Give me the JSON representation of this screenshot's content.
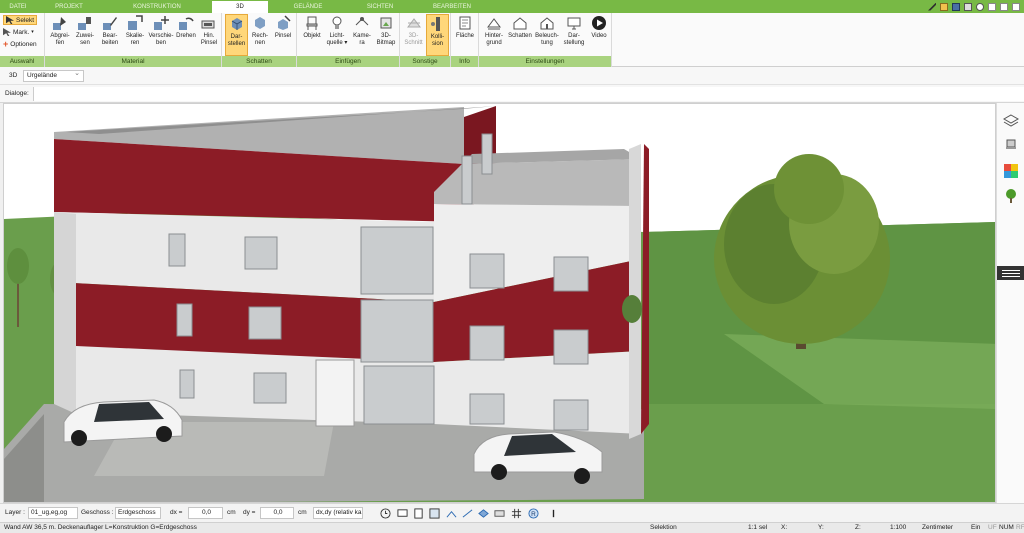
{
  "menu_tabs": [
    "DATEI",
    "PROJEKT",
    "KONSTRUKTION",
    "3D",
    "GELÄNDE",
    "SICHTEN",
    "BEARBEITEN"
  ],
  "ribbon": {
    "auswahl": {
      "label": "Auswahl",
      "selekt": "Selekt",
      "mark": "Mark.",
      "optionen": "Optionen"
    },
    "material": {
      "label": "Material",
      "buttons": [
        [
          "Abgrei-",
          "fen"
        ],
        [
          "Zuwei-",
          "sen"
        ],
        [
          "Bear-",
          "beiten"
        ],
        [
          "Skalie-",
          "ren"
        ],
        [
          "Verschie-",
          "ben"
        ],
        [
          "Drehen",
          ""
        ],
        [
          "Hin.",
          "Pinsel"
        ]
      ]
    },
    "schatten": {
      "label": "Schatten",
      "buttons": [
        [
          "Dar-",
          "stellen"
        ],
        [
          "Rech-",
          "nen"
        ],
        [
          "Pinsel",
          ""
        ]
      ]
    },
    "einfuegen": {
      "label": "Einfügen",
      "buttons": [
        [
          "Objekt",
          ""
        ],
        [
          "Licht-",
          "quelle"
        ],
        [
          "Kame-",
          "ra"
        ],
        [
          "3D-",
          "Bitmap"
        ]
      ]
    },
    "sonstige": {
      "label": "Sonstige",
      "buttons": [
        [
          "3D-",
          "Schnitt"
        ],
        [
          "Kolli-",
          "sion"
        ]
      ]
    },
    "info": {
      "label": "Info",
      "buttons": [
        [
          "Fläche",
          ""
        ]
      ]
    },
    "einstellungen": {
      "label": "Einstellungen",
      "buttons": [
        [
          "Hinter-",
          "grund"
        ],
        [
          "Schatten",
          ""
        ],
        [
          "Beleuch-",
          "tung"
        ],
        [
          "Dar-",
          "stellung"
        ],
        [
          "Video",
          ""
        ]
      ]
    }
  },
  "view_row": {
    "label": "3D",
    "selected": "Urgelände"
  },
  "dialog_row": {
    "label": "Dialoge:"
  },
  "bottom_bar": {
    "layer_label": "Layer :",
    "layer_value": "01_ug,eg,og",
    "geschoss_label": "Geschoss :",
    "geschoss_value": "Erdgeschoss",
    "dx_label": "dx =",
    "dx_value": "0,0",
    "dx_unit": "cm",
    "dy_label": "dy =",
    "dy_value": "0,0",
    "dy_unit": "cm",
    "mode_value": "dx,dy (relativ ka"
  },
  "status_bar": {
    "message": "Wand AW 36,5 m. Deckenauflager L=Konstruktion G=Erdgeschoss",
    "mode": "Selektion",
    "scale": "1:1 sel",
    "x_label": "X:",
    "y_label": "Y:",
    "z_label": "Z:",
    "zoom": "1:100",
    "unit": "Zentimeter",
    "ein": "Ein",
    "uf": "UF",
    "num": "NUM",
    "rf": "RF"
  },
  "colors": {
    "ribbon_green": "#78b945",
    "group_label_green": "#a9d37f",
    "facade_red": "#8c1c26",
    "facade_white": "#e9e9e9",
    "grass": "#6a9e4c",
    "sky": "#ffffff"
  }
}
